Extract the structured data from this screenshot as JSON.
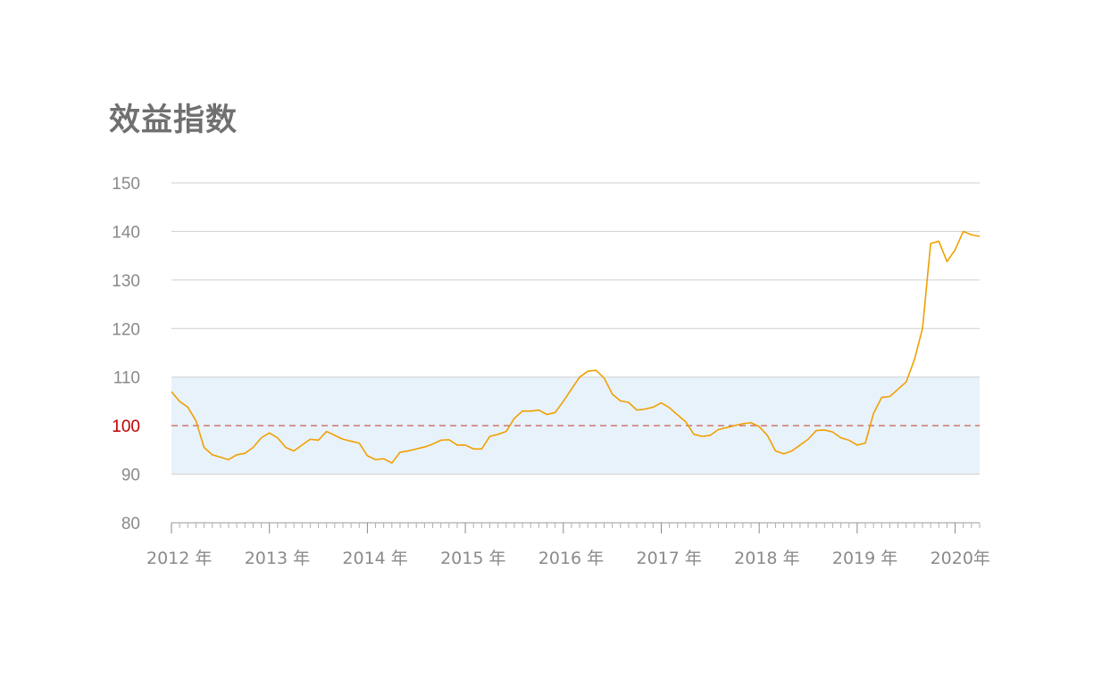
{
  "chart_data": {
    "type": "line",
    "title": "效益指数",
    "xlabel": "",
    "ylabel": "",
    "ylim": [
      80,
      150
    ],
    "yticks": [
      80,
      90,
      100,
      110,
      120,
      130,
      140,
      150
    ],
    "xlim": [
      2012.0,
      2020.25
    ],
    "xticks": [
      {
        "value": 2012,
        "label": "2012 年"
      },
      {
        "value": 2013,
        "label": "2013 年"
      },
      {
        "value": 2014,
        "label": "2014 年"
      },
      {
        "value": 2015,
        "label": "2015 年"
      },
      {
        "value": 2016,
        "label": "2016 年"
      },
      {
        "value": 2017,
        "label": "2017 年"
      },
      {
        "value": 2018,
        "label": "2018 年"
      },
      {
        "value": 2019,
        "label": "2019 年"
      },
      {
        "value": 2020,
        "label": "2020年"
      }
    ],
    "grid": true,
    "band": {
      "y0": 90,
      "y1": 110,
      "color": "#e8f2fb"
    },
    "reference_line": {
      "y": 100,
      "color": "#c0392b",
      "style": "dashed",
      "label_color": "#c00000"
    },
    "line_color": "#f0a000",
    "series": [
      {
        "x": [
          2012.0,
          2012.083,
          2012.167,
          2012.25,
          2012.333,
          2012.417,
          2012.5,
          2012.583,
          2012.667,
          2012.75,
          2012.833,
          2012.917,
          2013.0,
          2013.083,
          2013.167,
          2013.25,
          2013.333,
          2013.417,
          2013.5,
          2013.583,
          2013.667,
          2013.75,
          2013.833,
          2013.917,
          2014.0,
          2014.083,
          2014.167,
          2014.25,
          2014.333,
          2014.417,
          2014.5,
          2014.583,
          2014.667,
          2014.75,
          2014.833,
          2014.917,
          2015.0,
          2015.083,
          2015.167,
          2015.25,
          2015.333,
          2015.417,
          2015.5,
          2015.583,
          2015.667,
          2015.75,
          2015.833,
          2015.917,
          2016.0,
          2016.083,
          2016.167,
          2016.25,
          2016.333,
          2016.417,
          2016.5,
          2016.583,
          2016.667,
          2016.75,
          2016.833,
          2016.917,
          2017.0,
          2017.083,
          2017.167,
          2017.25,
          2017.333,
          2017.417,
          2017.5,
          2017.583,
          2017.667,
          2017.75,
          2017.833,
          2017.917,
          2018.0,
          2018.083,
          2018.167,
          2018.25,
          2018.333,
          2018.417,
          2018.5,
          2018.583,
          2018.667,
          2018.75,
          2018.833,
          2018.917,
          2019.0,
          2019.083,
          2019.167,
          2019.25,
          2019.333,
          2019.417,
          2019.5,
          2019.583,
          2019.667,
          2019.75,
          2019.833,
          2019.917,
          2020.0,
          2020.083,
          2020.167,
          2020.25
        ],
        "y": [
          107,
          105,
          103.8,
          101,
          95.5,
          94,
          93.5,
          93,
          94,
          94.3,
          95.5,
          97.5,
          98.5,
          97.5,
          95.5,
          94.8,
          96,
          97.2,
          97,
          98.8,
          98,
          97.2,
          96.8,
          96.4,
          93.8,
          93,
          93.2,
          92.3,
          94.5,
          94.8,
          95.2,
          95.6,
          96.2,
          97,
          97.1,
          96,
          96,
          95.2,
          95.2,
          97.8,
          98.2,
          98.8,
          101.5,
          103,
          103,
          103.2,
          102.3,
          102.7,
          105,
          107.5,
          110,
          111.2,
          111.4,
          109.8,
          106.5,
          105.1,
          104.8,
          103.2,
          103.4,
          103.8,
          104.7,
          103.7,
          102.2,
          100.8,
          98.2,
          97.8,
          98,
          99.2,
          99.6,
          100,
          100.4,
          100.6,
          99.8,
          98,
          94.8,
          94.2,
          94.8,
          96,
          97.2,
          99,
          99.1,
          98.7,
          97.5,
          97,
          96,
          96.4,
          102.5,
          105.8,
          106,
          107.5,
          109,
          113.5,
          120,
          137.5,
          138,
          133.8,
          136.2,
          140,
          139.3,
          139
        ]
      }
    ]
  }
}
